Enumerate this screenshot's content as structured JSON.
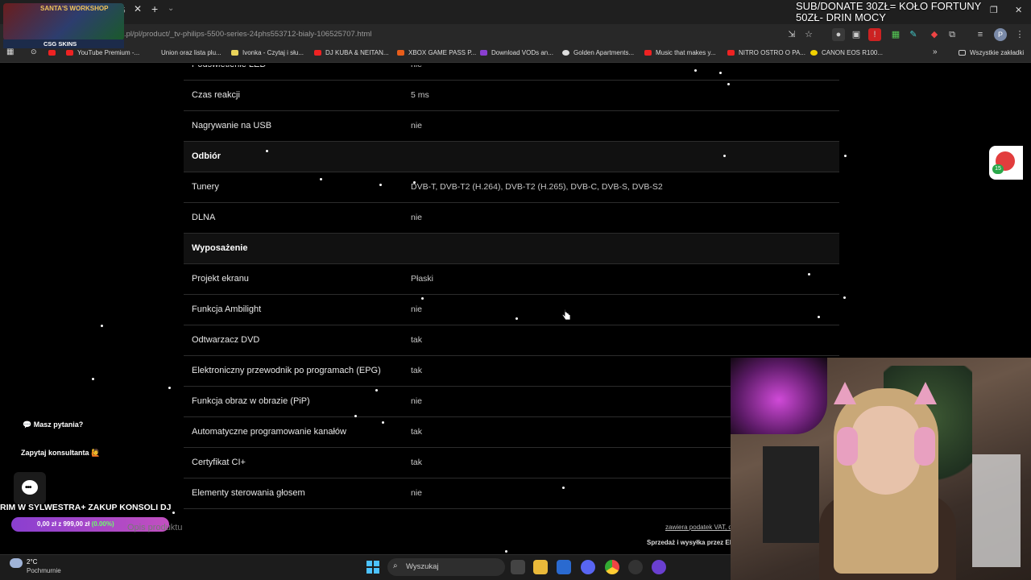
{
  "browser": {
    "tab_fragment": "5",
    "url": ".pl/pl/product/_tv-philips-5500-series-24phs553712-bialy-106525707.html",
    "bookmarks": [
      "YouTube Premium -...",
      "Union oraz lista plu...",
      "Ivonka - Czytaj i słu...",
      "DJ KUBA & NEITAN...",
      "XBOX GAME PASS P...",
      "Download VODs an...",
      "Golden Apartments...",
      "Music that makes y...",
      "NITRO OSTRO O PA...",
      "CANON EOS R100..."
    ],
    "all_bookmarks": "Wszystkie zakładki",
    "profile_letter": "P"
  },
  "overlay": {
    "logo_title": "SANTA'S WORKSHOP",
    "csg_label": "CSG SKINS",
    "donate_line1": "SUB/DONATE 30ZŁ= KOŁO FORTUNY",
    "donate_line2": "50ZŁ- DRIN MOCY",
    "goal_text": "RIM W SYLWESTRA+ ZAKUP KONSOLI DJ",
    "goal_value": "0,00 zł z 999,00 zł",
    "goal_percent": "(0.00%)",
    "gift_badge": "15"
  },
  "spec_rows": [
    {
      "key": "Podświetlenie LED",
      "value": "nie",
      "section": false
    },
    {
      "key": "Czas reakcji",
      "value": "5 ms",
      "section": false
    },
    {
      "key": "Nagrywanie na USB",
      "value": "nie",
      "section": false
    },
    {
      "key": "Odbiór",
      "value": "",
      "section": true
    },
    {
      "key": "Tunery",
      "value": "DVB-T, DVB-T2 (H.264), DVB-T2 (H.265), DVB-C, DVB-S, DVB-S2",
      "section": false
    },
    {
      "key": "DLNA",
      "value": "nie",
      "section": false
    },
    {
      "key": "Wyposażenie",
      "value": "",
      "section": true
    },
    {
      "key": "Projekt ekranu",
      "value": "Płaski",
      "section": false
    },
    {
      "key": "Funkcja Ambilight",
      "value": "nie",
      "section": false
    },
    {
      "key": "Odtwarzacz DVD",
      "value": "tak",
      "section": false
    },
    {
      "key": "Elektroniczny przewodnik po programach (EPG)",
      "value": "tak",
      "section": false
    },
    {
      "key": "Funkcja obraz w obrazie (PiP)",
      "value": "nie",
      "section": false
    },
    {
      "key": "Automatyczne programowanie kanałów",
      "value": "tak",
      "section": false
    },
    {
      "key": "Certyfikat CI+",
      "value": "tak",
      "section": false
    },
    {
      "key": "Elementy sterowania głosem",
      "value": "nie",
      "section": false
    }
  ],
  "chat": {
    "question": "💬 Masz pytania?",
    "ask": "Zapytaj konsultanta 🙋"
  },
  "page_footer": {
    "description_tab": "Opis produktu",
    "vat_note": "zawiera podatek VAT, d",
    "seller_note": "Sprzedaż i wysyłka przez Ele"
  },
  "taskbar": {
    "temperature": "2°C",
    "weather": "Pochmurnie",
    "search_placeholder": "Wyszukaj"
  },
  "colors": {
    "page_bg": "#000000",
    "row_border": "#2c2c2c",
    "goal_bar": "#b04ec8",
    "goal_percent": "#6cff6c"
  }
}
